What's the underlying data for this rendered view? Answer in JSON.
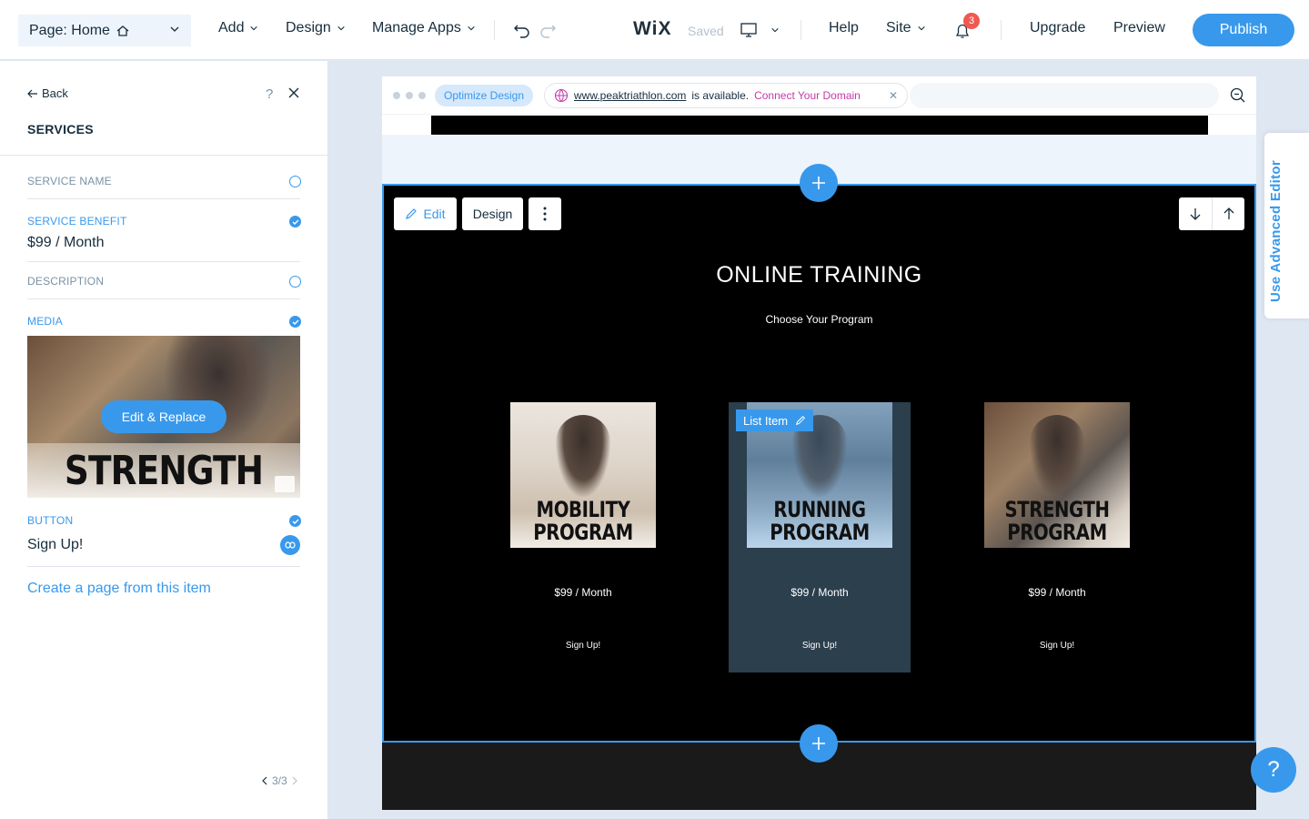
{
  "topbar": {
    "page_label": "Page: Home",
    "menu": {
      "add": "Add",
      "design": "Design",
      "manage_apps": "Manage Apps"
    },
    "logo": "WiX",
    "saved": "Saved",
    "help": "Help",
    "site": "Site",
    "notifications": "3",
    "upgrade": "Upgrade",
    "preview": "Preview",
    "publish": "Publish"
  },
  "panel": {
    "back": "Back",
    "help": "?",
    "title": "SERVICES",
    "fields": {
      "service_name": "SERVICE NAME",
      "service_benefit": "SERVICE BENEFIT",
      "service_benefit_value": "$99 / Month",
      "description": "DESCRIPTION",
      "media": "MEDIA",
      "button": "BUTTON",
      "button_value": "Sign Up!"
    },
    "media_text": "STRENGTH",
    "edit_replace": "Edit & Replace",
    "create_page": "Create a page from this item",
    "pager": "3/3"
  },
  "browser": {
    "optimize": "Optimize Design",
    "domain_url": "www.peaktriathlon.com",
    "domain_msg": "is available.",
    "connect": "Connect Your Domain"
  },
  "section": {
    "edit": "Edit",
    "design": "Design",
    "title": "ONLINE TRAINING",
    "subtitle": "Choose Your Program",
    "list_item_tag": "List Item",
    "cards": [
      {
        "img_line1": "MOBILITY",
        "img_line2": "PROGRAM",
        "price": "$99 / Month",
        "button": "Sign Up!"
      },
      {
        "img_line1": "RUNNING",
        "img_line2": "PROGRAM",
        "price": "$99 / Month",
        "button": "Sign Up!"
      },
      {
        "img_line1": "STRENGTH",
        "img_line2": "PROGRAM",
        "price": "$99 / Month",
        "button": "Sign Up!"
      }
    ]
  },
  "advanced_editor": "Use Advanced Editor",
  "help_fab": "?",
  "colors": {
    "accent": "#3899ec",
    "badge": "#ee5951",
    "connect": "#c43aa8"
  }
}
